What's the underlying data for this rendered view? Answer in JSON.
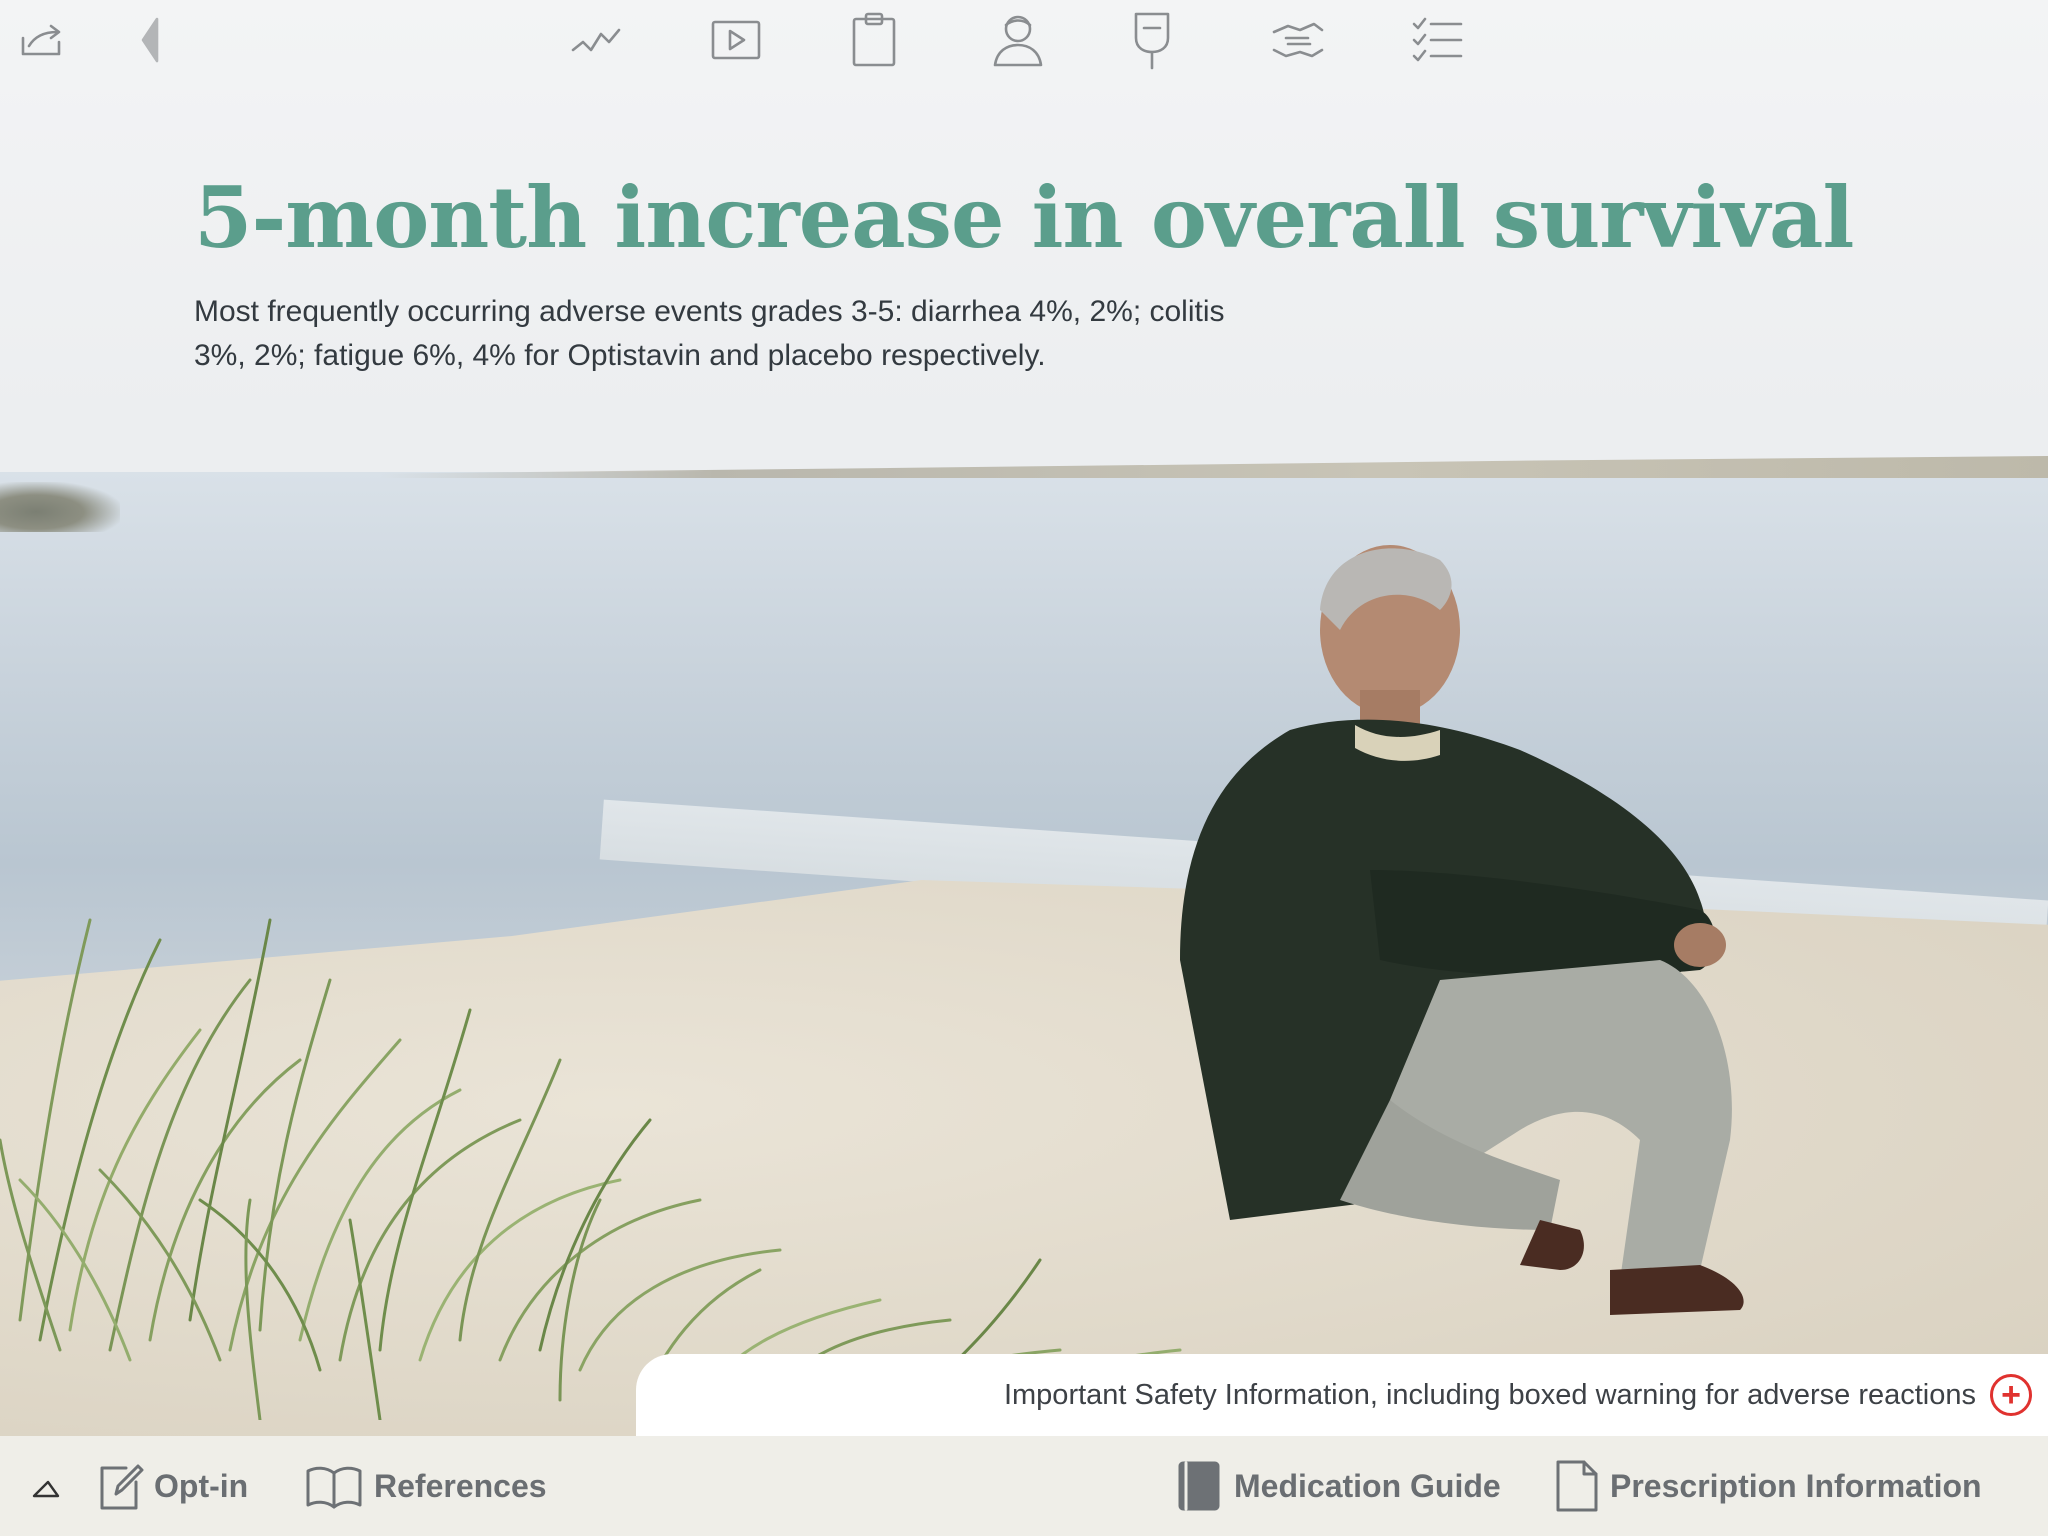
{
  "toolbar": {
    "icons": [
      "share-icon",
      "back-arrow-icon",
      "trend-chart-icon",
      "video-play-icon",
      "clipboard-icon",
      "patient-icon",
      "iv-bag-icon",
      "handshake-icon",
      "checklist-icon"
    ]
  },
  "content": {
    "headline": "5-month increase in overall survival",
    "subtext_line1": "Most frequently occurring adverse events grades 3-5: diarrhea 4%, 2%; colitis",
    "subtext_line2": "3%, 2%; fatigue 6%, 4% for Optistavin and placebo respectively."
  },
  "safety": {
    "label": "Important Safety Information, including boxed warning for adverse reactions",
    "plus": "+"
  },
  "bottom_bar": {
    "optin_label": "Opt-in",
    "references_label": "References",
    "medication_guide_label": "Medication Guide",
    "prescription_label": "Prescription Information"
  },
  "colors": {
    "headline": "#5b9e8c",
    "safety_plus": "#e0322f",
    "bottom_bar_bg": "#efeee8"
  }
}
